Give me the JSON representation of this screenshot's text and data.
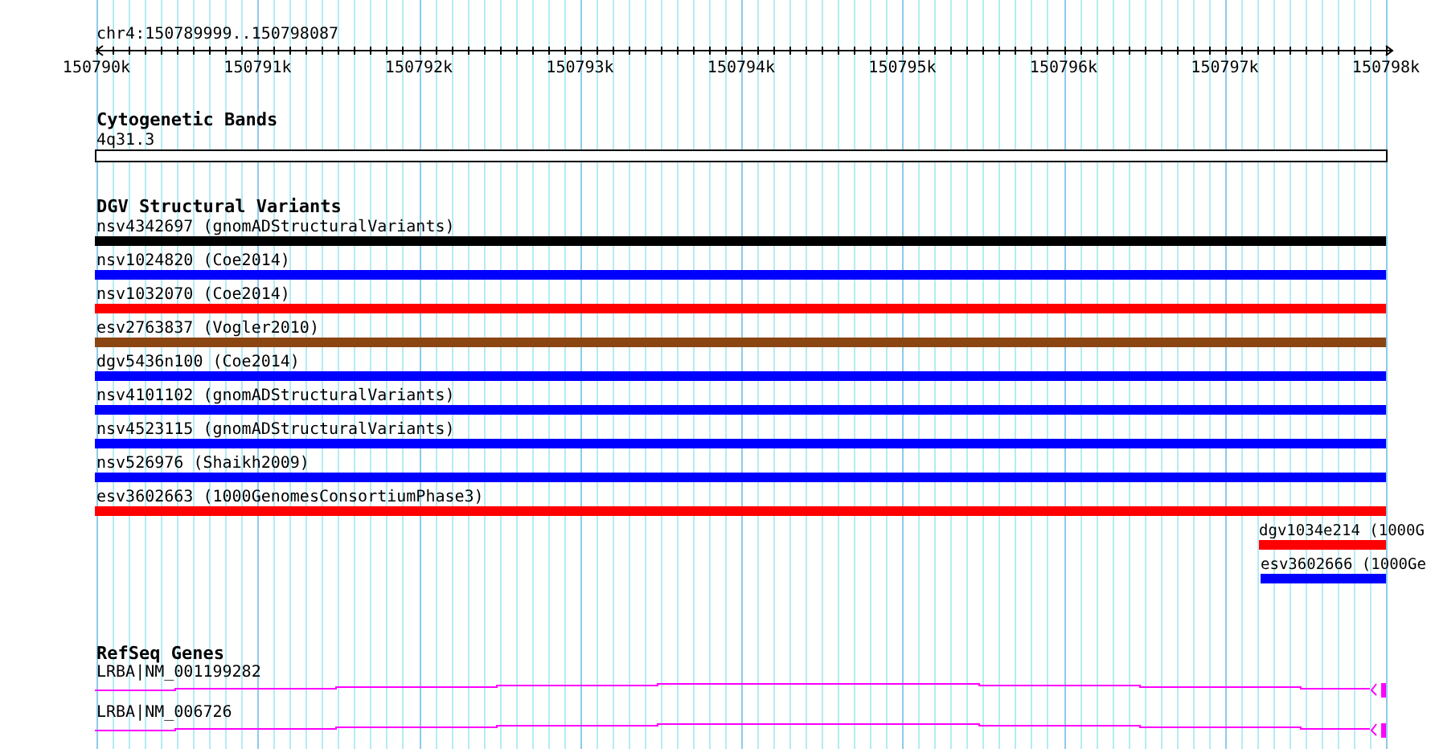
{
  "ruler": {
    "location": "chr4:150789999..150798087",
    "ticks": [
      "150790k",
      "150791k",
      "150792k",
      "150793k",
      "150794k",
      "150795k",
      "150796k",
      "150797k",
      "150798k"
    ]
  },
  "tracks": [
    {
      "kind": "bands",
      "title": "Cytogenetic Bands",
      "items": [
        {
          "label": "4q31.3"
        }
      ]
    },
    {
      "kind": "variants",
      "title": "DGV Structural Variants",
      "items": [
        {
          "label": "nsv4342697 (gnomADStructuralVariants)",
          "color": "#000000",
          "kind": "full"
        },
        {
          "label": "nsv1024820 (Coe2014)",
          "color": "#0000ff",
          "kind": "full"
        },
        {
          "label": "nsv1032070 (Coe2014)",
          "color": "#ff0000",
          "kind": "full"
        },
        {
          "label": "esv2763837 (Vogler2010)",
          "color": "#8b4513",
          "kind": "full"
        },
        {
          "label": "dgv5436n100 (Coe2014)",
          "color": "#0000ff",
          "kind": "full"
        },
        {
          "label": "nsv4101102 (gnomADStructuralVariants)",
          "color": "#0000ff",
          "kind": "full"
        },
        {
          "label": "nsv4523115 (gnomADStructuralVariants)",
          "color": "#0000ff",
          "kind": "full"
        },
        {
          "label": "nsv526976 (Shaikh2009)",
          "color": "#0000ff",
          "kind": "full"
        },
        {
          "label": "esv3602663 (1000GenomesConsortiumPhase3)",
          "color": "#ff0000",
          "kind": "full"
        },
        {
          "label": "dgv1034e214 (1000G",
          "color": "#ff0000",
          "kind": "right"
        },
        {
          "label": "esv3602666 (1000Ge",
          "color": "#0000ff",
          "kind": "right"
        }
      ]
    },
    {
      "kind": "genes",
      "title": "RefSeq Genes",
      "items": [
        {
          "label": "LRBA|NM_001199282"
        },
        {
          "label": "LRBA|NM_006726"
        }
      ]
    }
  ]
}
